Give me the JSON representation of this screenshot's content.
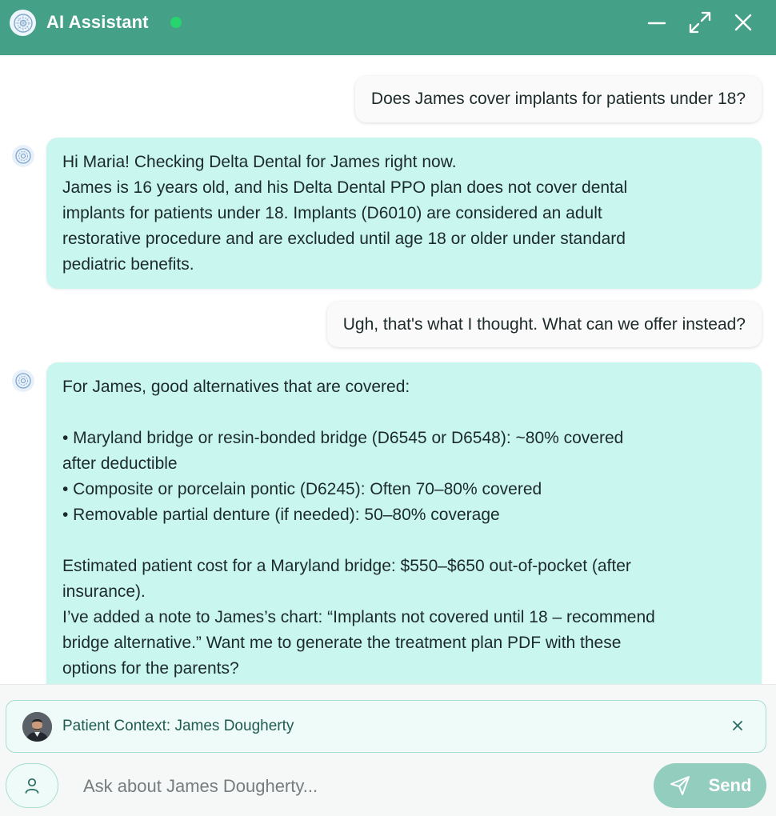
{
  "header": {
    "title": "AI Assistant",
    "accent_color": "#44a087",
    "status_color": "#27d46d",
    "icons": [
      "minimize-icon",
      "expand-icon",
      "close-icon"
    ]
  },
  "chat": {
    "messages": [
      {
        "role": "user",
        "text": "Does James cover implants for patients under 18?"
      },
      {
        "role": "assistant",
        "lines": [
          "Hi Maria! Checking Delta Dental for James right now.",
          "James is 16 years old, and his Delta Dental PPO plan does not cover dental",
          "implants for patients under 18. Implants (D6010) are considered an adult",
          "restorative procedure and are excluded until age 18 or older under standard",
          "pediatric benefits."
        ]
      },
      {
        "role": "user",
        "text": "Ugh, that's what I thought. What can we offer instead?"
      },
      {
        "role": "assistant",
        "lines": [
          "For James, good alternatives that are covered:",
          "",
          "• Maryland bridge or resin-bonded bridge (D6545 or D6548): ~80% covered",
          "after deductible",
          "• Composite or porcelain pontic (D6245): Often 70–80% covered",
          "• Removable partial denture (if needed): 50–80% coverage",
          "",
          "Estimated patient cost for a Maryland bridge: $550–$650 out-of-pocket (after",
          "insurance).",
          "I’ve added a note to James’s chart: “Implants not covered until 18 – recommend",
          "bridge alternative.” Want me to generate the treatment plan PDF with these",
          "options for the parents?"
        ]
      }
    ]
  },
  "context": {
    "label": "Patient Context: James Dougherty"
  },
  "composer": {
    "placeholder": "Ask about James Dougherty...",
    "send_label": "Send",
    "send_color": "#92cdbd"
  }
}
